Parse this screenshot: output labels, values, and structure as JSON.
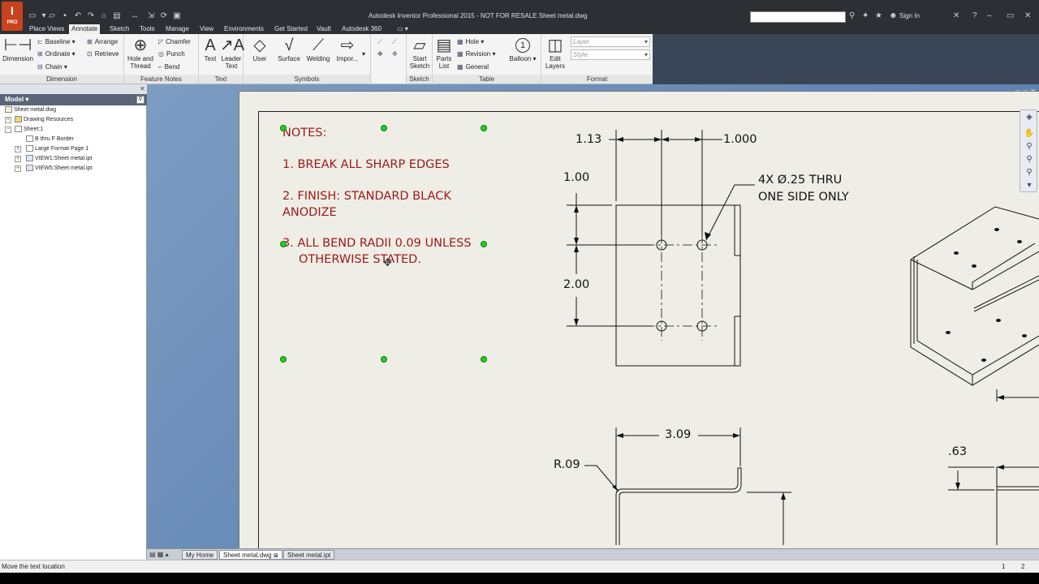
{
  "app": {
    "logo_letter": "I",
    "logo_sub": "PRO",
    "title": "Autodesk Inventor Professional 2015 - NOT FOR RESALE   Sheet metal.dwg",
    "sign_in": "Sign In"
  },
  "tabs": [
    {
      "label": "Place Views"
    },
    {
      "label": "Annotate"
    },
    {
      "label": "Sketch"
    },
    {
      "label": "Tools"
    },
    {
      "label": "Manage"
    },
    {
      "label": "View"
    },
    {
      "label": "Environments"
    },
    {
      "label": "Get Started"
    },
    {
      "label": "Vault"
    },
    {
      "label": "Autodesk 360"
    }
  ],
  "active_tab": "Annotate",
  "ribbon": {
    "dimension": {
      "group": "Dimension",
      "dimension": "Dimension",
      "baseline": "Baseline",
      "ordinate": "Ordinate",
      "chain": "Chain",
      "arrange": "Arrange",
      "retrieve": "Retrieve"
    },
    "feature_notes": {
      "group": "Feature Notes",
      "hole_thread": "Hole and Thread",
      "chamfer": "Chamfer",
      "punch": "Punch",
      "bend": "Bend"
    },
    "text": {
      "group": "Text",
      "text": "Text",
      "leader_text": "Leader Text"
    },
    "symbols": {
      "group": "Symbols",
      "user": "User",
      "surface": "Surface",
      "welding": "Welding",
      "import": "Impor..."
    },
    "sketch": {
      "group": "Sketch",
      "start_sketch": "Start Sketch"
    },
    "table": {
      "group": "Table",
      "parts_list": "Parts List",
      "hole": "Hole",
      "revision": "Revision",
      "general": "General",
      "balloon": "Balloon",
      "balloon_num": "1"
    },
    "format": {
      "group": "Format",
      "edit_layers": "Edit Layers",
      "layer_placeholder": "Layer",
      "style_placeholder": "Style"
    }
  },
  "browser": {
    "header": "Model",
    "items": [
      {
        "label": "Sheet metal.dwg"
      },
      {
        "label": "Drawing Resources"
      },
      {
        "label": "Sheet:1"
      },
      {
        "label": "B thru F Border"
      },
      {
        "label": "Large Format Page 1"
      },
      {
        "label": "VIEW1:Sheet metal.ipt"
      },
      {
        "label": "VIEW5:Sheet metal.ipt"
      }
    ]
  },
  "drawing": {
    "notes": {
      "title": "NOTES:",
      "line1": "1. BREAK ALL SHARP EDGES",
      "line2a": "2. FINISH: STANDARD BLACK",
      "line2b": "ANODIZE",
      "line3a": "3. ALL BEND RADII 0.09 UNLESS",
      "line3b": "OTHERWISE STATED."
    },
    "dims": {
      "d1": "1.13",
      "d2": "1.000",
      "d3": "1.00",
      "d4": "2.00",
      "hole_note_1": "4X Ø.25 THRU",
      "hole_note_2": "ONE SIDE ONLY",
      "d5": "3.09",
      "d6": "R.09",
      "d7": ".63"
    },
    "colors": {
      "note_text": "#a01818",
      "grip": "#22d022",
      "canvas_bg": "#6a8bb8",
      "sheet": "#eeeee6"
    }
  },
  "doc_tabs": [
    {
      "label": "My Home"
    },
    {
      "label": "Sheet metal.dwg"
    },
    {
      "label": "Sheet metal.ipt"
    }
  ],
  "status": {
    "message": "Move the text location",
    "num1": "1",
    "num2": "2"
  }
}
